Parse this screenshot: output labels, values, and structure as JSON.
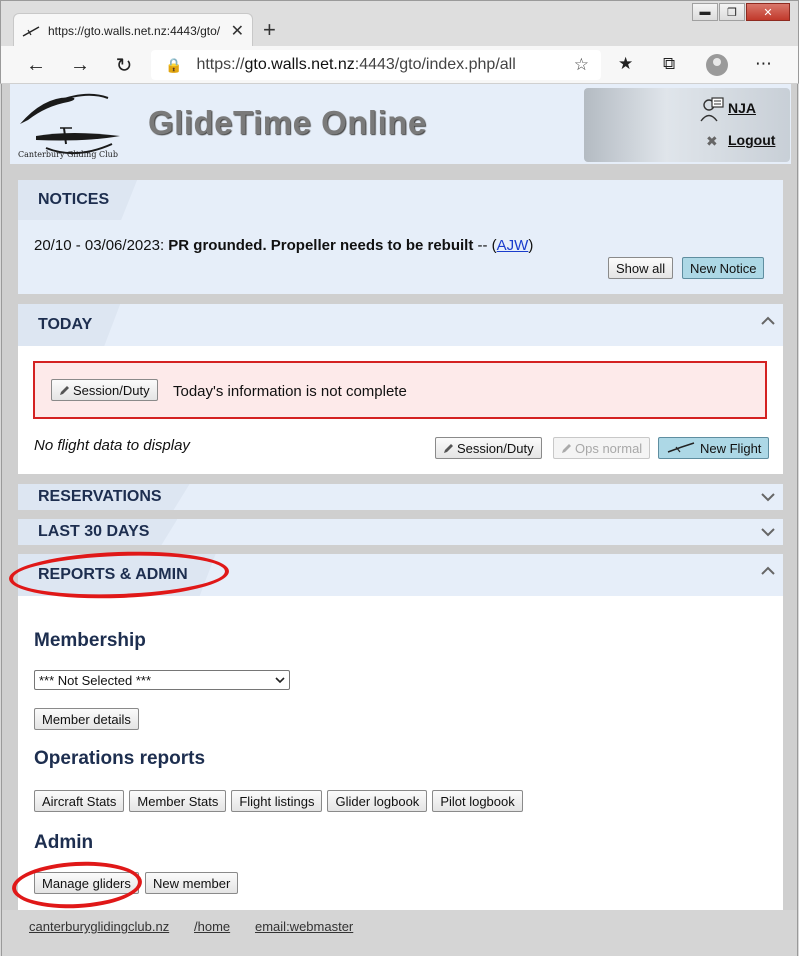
{
  "browser": {
    "tab_title": "https://gto.walls.net.nz:4443/gto/",
    "tab_close": "✕",
    "new_tab": "+",
    "url_prefix": "https://",
    "url_host": "gto.walls.net.nz",
    "url_rest": ":4443/gto/index.php/all",
    "window_controls": [
      "▬",
      "❐",
      "✕"
    ]
  },
  "header": {
    "site_title": "GlideTime Online",
    "logo_text": "Canterbury   Gliding   Club",
    "user": "NJA",
    "logout": "Logout"
  },
  "notices": {
    "title": "NOTICES",
    "item_dates": "20/10 - 03/06/2023:",
    "item_text": "PR grounded. Propeller needs to be rebuilt",
    "item_sep": "-- (",
    "item_author": "AJW",
    "item_close": ")",
    "show_all": "Show all",
    "new_notice": "New Notice"
  },
  "today": {
    "title": "TODAY",
    "alert_button": "Session/Duty",
    "alert_text": "Today's information is not complete",
    "no_data": "No flight data to display",
    "session_button": "Session/Duty",
    "ops_button": "Ops normal",
    "new_flight": "New Flight"
  },
  "reservations": {
    "title": "RESERVATIONS"
  },
  "last30": {
    "title": "LAST 30 DAYS"
  },
  "reports": {
    "title": "REPORTS & ADMIN",
    "membership_heading": "Membership",
    "member_select": "*** Not Selected ***",
    "member_details": "Member details",
    "ops_heading": "Operations reports",
    "ops_buttons": [
      "Aircraft Stats",
      "Member Stats",
      "Flight listings",
      "Glider logbook",
      "Pilot logbook"
    ],
    "admin_heading": "Admin",
    "manage_gliders": "Manage gliders",
    "new_member": "New member"
  },
  "footer": {
    "link1": "canterburyglidingclub.nz",
    "link2": "/home",
    "link3": "email:webmaster"
  },
  "colors": {
    "section_header_bg": "#e6eef9",
    "heading_text": "#1d2e4f",
    "alert_bg": "#fdeaea",
    "alert_border": "#d42222",
    "highlight_oval": "#e01818",
    "blue_button": "#add8e6"
  }
}
